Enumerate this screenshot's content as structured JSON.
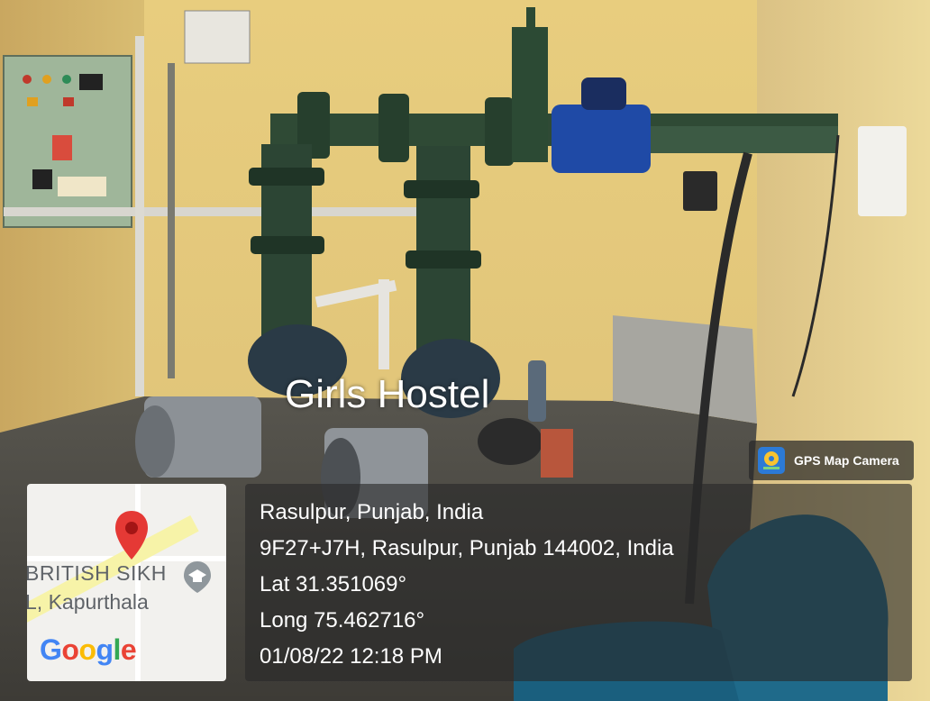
{
  "overlay": {
    "title": "Girls Hostel"
  },
  "map": {
    "label_line1": "BRITISH SIKH",
    "label_line2": "L, Kapurthala",
    "logo": [
      "G",
      "o",
      "o",
      "g",
      "l",
      "e"
    ],
    "logo_colors": [
      "#4285F4",
      "#EA4335",
      "#FBBC05",
      "#4285F4",
      "#34A853",
      "#EA4335"
    ],
    "pin_color": "#e53935",
    "icon": "graduation-cap-icon"
  },
  "badge": {
    "label": "GPS Map Camera",
    "icon": "map-camera-icon"
  },
  "location": {
    "place": "Rasulpur, Punjab, India",
    "address": "9F27+J7H, Rasulpur, Punjab 144002, India",
    "lat": "Lat 31.351069°",
    "long": "Long 75.462716°",
    "datetime": "01/08/22 12:18 PM"
  }
}
